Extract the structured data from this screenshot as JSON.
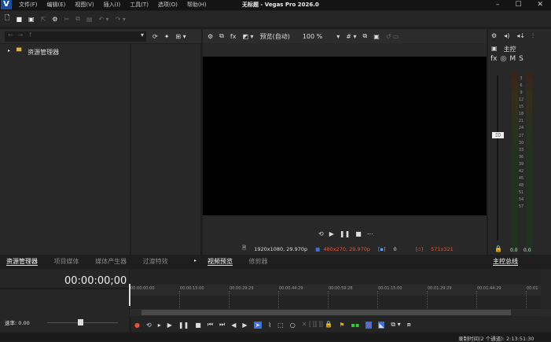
{
  "window": {
    "title": "无标题 - Vegas Pro 2026.0",
    "logo": "V",
    "min": "–",
    "max": "☐",
    "close": "✕"
  },
  "menu": [
    "文件(F)",
    "编辑(E)",
    "视图(V)",
    "插入(I)",
    "工具(T)",
    "选项(O)",
    "帮助(H)"
  ],
  "explorer": {
    "tree_item": "资源管理器",
    "back": "←",
    "forward": "→",
    "up": "↑"
  },
  "preview": {
    "mode": "预览(自动)",
    "zoom": "100 %",
    "project_res": "1920x1080, 29.970p",
    "preview_res": "480x270, 29.970p",
    "frame": "0",
    "display": "571x321",
    "accent_red": "#e0553a"
  },
  "mixer": {
    "master": "主控",
    "fx": "fx",
    "m": "M",
    "s": "S",
    "scale": [
      "3",
      "6",
      "9",
      "12",
      "15",
      "18",
      "21",
      "24",
      "27",
      "30",
      "33",
      "36",
      "39",
      "42",
      "45",
      "48",
      "51",
      "54",
      "57"
    ],
    "peak_l": "0.0",
    "peak_r": "0.0"
  },
  "tabs_left": [
    "资源管理器",
    "项目媒体",
    "媒体产生器",
    "过渡特效"
  ],
  "tabs_mid": [
    "视频预览",
    "修剪器"
  ],
  "tab_right": "主控总线",
  "timeline": {
    "timecode": "00:00:00;00",
    "rate": "速率: 0.00",
    "ruler": [
      "00:00:00:00",
      "00:00:15:00",
      "00:00:29:29",
      "00:00:44:29",
      "00:00:59:28",
      "00:01:15:00",
      "00:01:29:29",
      "00:01:44:29",
      "00:01"
    ]
  },
  "status": "录制时间(2 个通道): 2:13:51:30"
}
